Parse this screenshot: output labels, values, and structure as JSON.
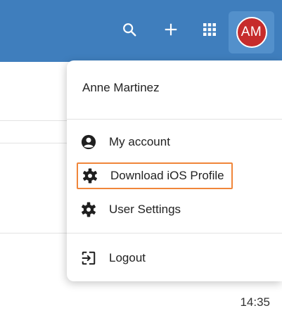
{
  "topbar": {
    "icons": [
      "search-icon",
      "plus-icon",
      "apps-grid-icon"
    ],
    "avatar_initials": "AM",
    "background": "#3f7ebd",
    "avatar_color": "#c62c2c"
  },
  "menu": {
    "user_name": "Anne Martinez",
    "items": [
      {
        "label": "My account",
        "icon": "account-circle-icon"
      },
      {
        "label": "Download iOS Profile",
        "icon": "gear-icon",
        "highlighted": true
      },
      {
        "label": "User Settings",
        "icon": "gear-icon"
      },
      {
        "label": "Logout",
        "icon": "logout-icon"
      }
    ],
    "highlight_color": "#f0863a"
  },
  "status": {
    "time": "14:35"
  }
}
